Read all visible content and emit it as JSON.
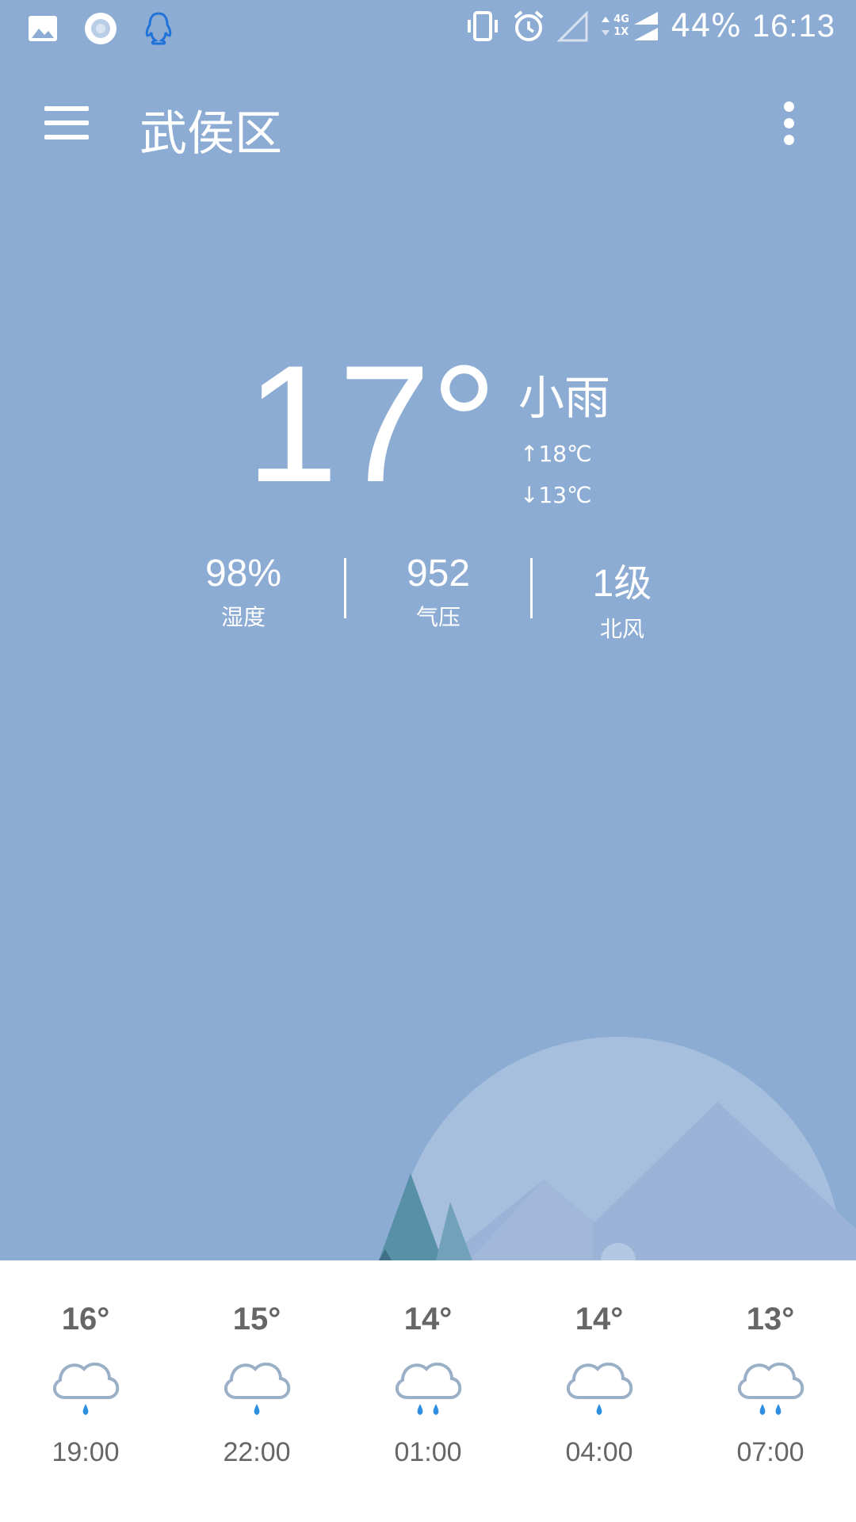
{
  "status_bar": {
    "battery": "44%",
    "time": "16:13",
    "net_top": "4G",
    "net_bottom": "1X"
  },
  "header": {
    "title": "武侯区"
  },
  "current": {
    "temperature": "17°",
    "condition": "小雨",
    "high": "↑18℃",
    "low": "↓13℃",
    "metrics": [
      {
        "value": "98%",
        "label": "湿度"
      },
      {
        "value": "952",
        "label": "气压"
      },
      {
        "value": "1级",
        "label": "北风"
      }
    ]
  },
  "forecast": [
    {
      "temp": "16°",
      "time": "19:00",
      "icon": "cloud-light-rain-icon",
      "drops": 1
    },
    {
      "temp": "15°",
      "time": "22:00",
      "icon": "cloud-light-rain-icon",
      "drops": 1
    },
    {
      "temp": "14°",
      "time": "01:00",
      "icon": "cloud-rain-icon",
      "drops": 2
    },
    {
      "temp": "14°",
      "time": "04:00",
      "icon": "cloud-light-rain-icon",
      "drops": 1
    },
    {
      "temp": "13°",
      "time": "07:00",
      "icon": "cloud-rain-icon",
      "drops": 2
    }
  ],
  "colors": {
    "background": "#8dacd4",
    "cloud_outline": "#9ab0c6",
    "rain_drop": "#2f8fe0",
    "card": "#ffffff"
  }
}
